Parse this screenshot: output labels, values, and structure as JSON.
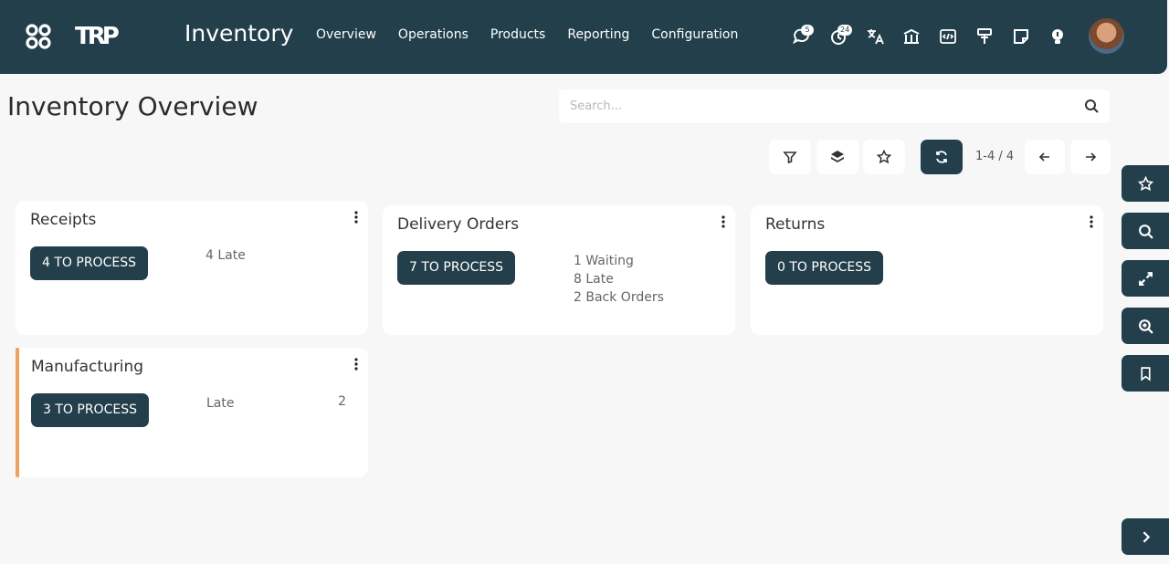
{
  "app": {
    "brand": "TRP",
    "title": "Inventory"
  },
  "menu": [
    "Overview",
    "Operations",
    "Products",
    "Reporting",
    "Configuration"
  ],
  "systray": [
    {
      "icon": "chat-icon",
      "badge": "5"
    },
    {
      "icon": "activity-clock-icon",
      "badge": "24"
    },
    {
      "icon": "translate-icon",
      "badge": ""
    },
    {
      "icon": "bank-icon",
      "badge": ""
    },
    {
      "icon": "code-icon",
      "badge": ""
    },
    {
      "icon": "paint-roller-icon",
      "badge": ""
    },
    {
      "icon": "sticky-note-icon",
      "badge": ""
    },
    {
      "icon": "lightbulb-icon",
      "badge": ""
    }
  ],
  "page": {
    "title": "Inventory Overview"
  },
  "search": {
    "placeholder": "Search..."
  },
  "pager": {
    "text": "1-4 / 4"
  },
  "cards": [
    {
      "title": "Receipts",
      "button": "4 TO PROCESS",
      "stats": [
        "4 Late"
      ],
      "value": ""
    },
    {
      "title": "Delivery Orders",
      "button": "7 TO PROCESS",
      "stats": [
        "1 Waiting",
        "8 Late",
        "2 Back Orders"
      ],
      "value": ""
    },
    {
      "title": "Returns",
      "button": "0 TO PROCESS",
      "stats": [],
      "value": ""
    },
    {
      "title": "Manufacturing",
      "button": "3 TO PROCESS",
      "stats": [
        "Late"
      ],
      "value": "2"
    }
  ],
  "colors": {
    "primary": "#233f4b",
    "accent": "#f0a35e",
    "background": "#f7f7f7"
  }
}
